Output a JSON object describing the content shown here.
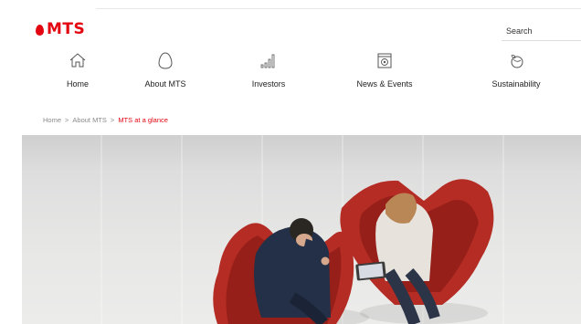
{
  "brand": {
    "logo_text": "MTS",
    "accent": "#e30611"
  },
  "search": {
    "placeholder": "Search"
  },
  "nav": [
    {
      "label": "Home",
      "icon": "home-icon"
    },
    {
      "label": "About MTS",
      "icon": "egg-icon"
    },
    {
      "label": "Investors",
      "icon": "bar-chart-icon"
    },
    {
      "label": "News & Events",
      "icon": "calendar-icon"
    },
    {
      "label": "Sustainability",
      "icon": "globe-plant-icon"
    }
  ],
  "breadcrumb": {
    "home": "Home",
    "about": "About MTS",
    "current": "MTS at a glance",
    "separator": ">"
  },
  "hero": {
    "description": "Two people in business attire seated in red armchairs looking at a tablet, viewed from above"
  }
}
